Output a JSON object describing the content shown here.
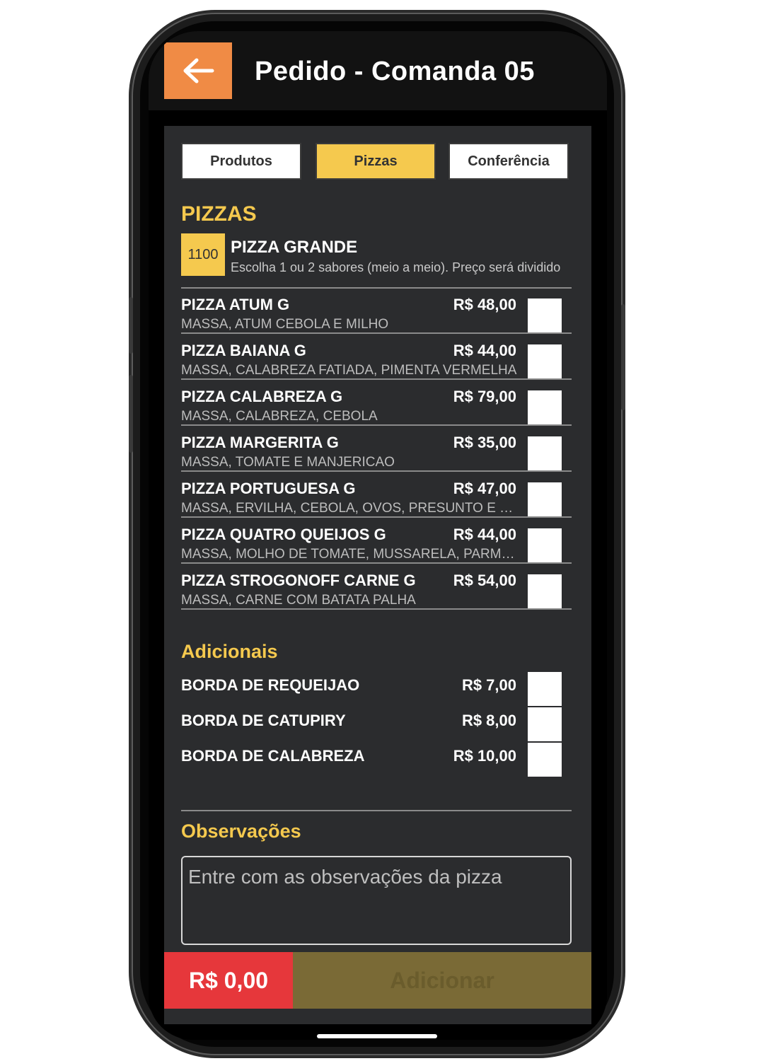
{
  "header": {
    "title": "Pedido - Comanda 05",
    "back_icon": "arrow-left-icon"
  },
  "tabs": [
    {
      "label": "Produtos",
      "active": false
    },
    {
      "label": "Pizzas",
      "active": true
    },
    {
      "label": "Conferência",
      "active": false
    }
  ],
  "pizzas": {
    "section_title": "PIZZAS",
    "group": {
      "code": "1100",
      "name": "PIZZA GRANDE",
      "description": "Escolha 1 ou 2 sabores (meio a meio). Preço será dividido"
    },
    "items": [
      {
        "name": "PIZZA ATUM G",
        "price": "R$ 48,00",
        "description": "MASSA, ATUM CEBOLA E MILHO",
        "checked": false
      },
      {
        "name": "PIZZA BAIANA G",
        "price": "R$ 44,00",
        "description": "MASSA, CALABREZA FATIADA, PIMENTA VERMELHA",
        "checked": false
      },
      {
        "name": "PIZZA CALABREZA G",
        "price": "R$ 79,00",
        "description": "MASSA, CALABREZA, CEBOLA",
        "checked": false
      },
      {
        "name": "PIZZA MARGERITA G",
        "price": "R$ 35,00",
        "description": "MASSA, TOMATE E MANJERICAO",
        "checked": false
      },
      {
        "name": "PIZZA PORTUGUESA G",
        "price": "R$ 47,00",
        "description": "MASSA,  ERVILHA, CEBOLA, OVOS, PRESUNTO E MUSSARELA",
        "checked": false
      },
      {
        "name": "PIZZA QUATRO QUEIJOS G",
        "price": "R$ 44,00",
        "description": "MASSA, MOLHO DE TOMATE,  MUSSARELA, PARMESAO",
        "checked": false
      },
      {
        "name": "PIZZA STROGONOFF CARNE G",
        "price": "R$ 54,00",
        "description": "MASSA, CARNE COM BATATA PALHA",
        "checked": false
      }
    ]
  },
  "adicionais": {
    "section_title": "Adicionais",
    "items": [
      {
        "name": "BORDA DE REQUEIJAO",
        "price": "R$ 7,00",
        "checked": false
      },
      {
        "name": "BORDA DE CATUPIRY",
        "price": "R$ 8,00",
        "checked": false
      },
      {
        "name": "BORDA DE CALABREZA",
        "price": "R$ 10,00",
        "checked": false
      }
    ]
  },
  "observacoes": {
    "section_title": "Observações",
    "placeholder": "Entre com as observações da pizza",
    "value": ""
  },
  "footer": {
    "total": "R$ 0,00",
    "add_label": "Adicionar"
  },
  "colors": {
    "accent": "#f5c94e",
    "back_button": "#f08b45",
    "total": "#e6373b",
    "add_disabled": "#7a6a36",
    "panel": "#2b2c2e"
  }
}
